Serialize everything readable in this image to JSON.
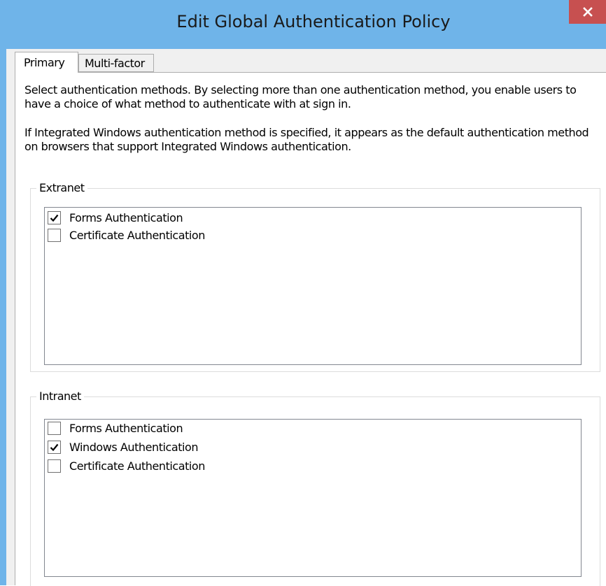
{
  "window": {
    "title": "Edit Global Authentication Policy",
    "close_glyph": "x"
  },
  "tabs": [
    {
      "label": "Primary",
      "selected": true
    },
    {
      "label": "Multi-factor",
      "selected": false
    }
  ],
  "description": {
    "paragraph1": "Select authentication methods. By selecting more than one authentication method, you enable users to have a choice of what method to authenticate with at sign in.",
    "paragraph2": "If Integrated Windows authentication method is specified, it appears as the default authentication method on browsers that support Integrated Windows authentication."
  },
  "extranet": {
    "label": "Extranet",
    "items": [
      {
        "label": "Forms Authentication",
        "checked": true
      },
      {
        "label": "Certificate Authentication",
        "checked": false
      }
    ]
  },
  "intranet": {
    "label": "Intranet",
    "items": [
      {
        "label": "Forms Authentication",
        "checked": false
      },
      {
        "label": "Windows Authentication",
        "checked": true
      },
      {
        "label": "Certificate Authentication",
        "checked": false
      }
    ]
  },
  "colors": {
    "title_bar": "#6fb4e9",
    "close_button": "#c75050",
    "dialog_background": "#f0f0f0"
  },
  "icons": {
    "close": "close-icon",
    "check": "checkmark-icon"
  }
}
